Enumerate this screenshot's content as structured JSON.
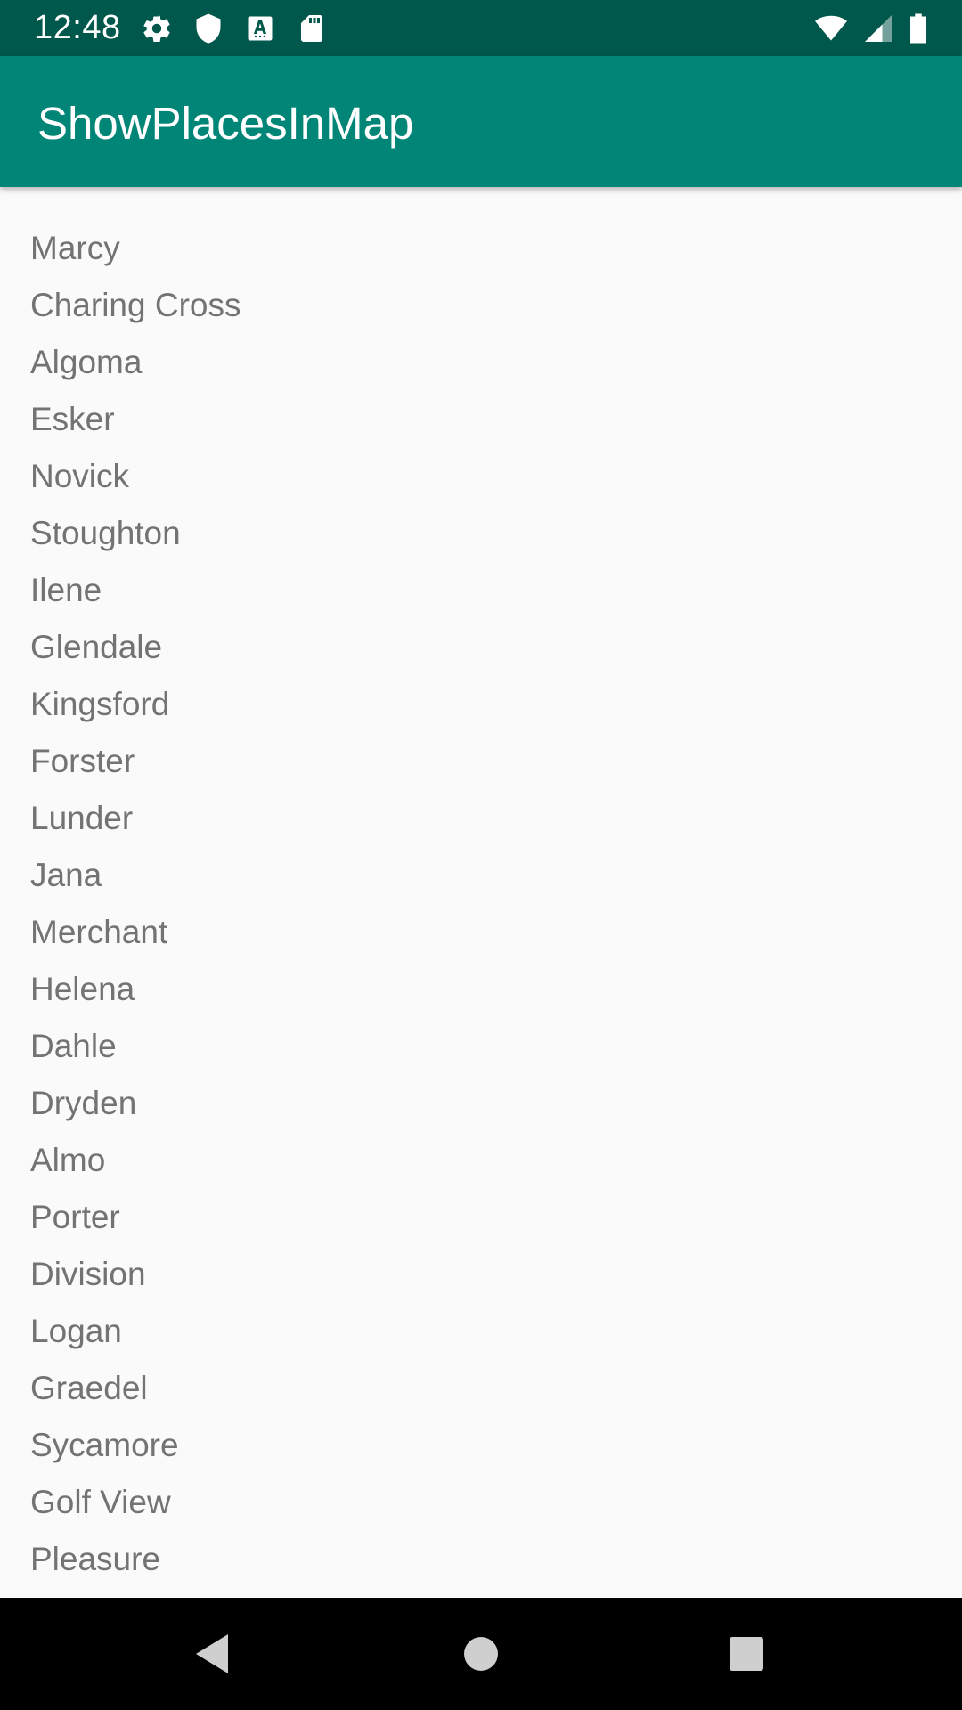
{
  "status_bar": {
    "time": "12:48",
    "left_icons": [
      "gear-icon",
      "shield-icon",
      "keyboard-a-icon",
      "sd-card-icon"
    ],
    "right_icons": [
      "wifi-icon",
      "cellular-signal-icon",
      "battery-icon"
    ]
  },
  "app_bar": {
    "title": "ShowPlacesInMap",
    "color": "#008577"
  },
  "places": [
    "Marcy",
    "Charing Cross",
    "Algoma",
    "Esker",
    "Novick",
    "Stoughton",
    "Ilene",
    "Glendale",
    "Kingsford",
    "Forster",
    "Lunder",
    "Jana",
    "Merchant",
    "Helena",
    "Dahle",
    "Dryden",
    "Almo",
    "Porter",
    "Division",
    "Logan",
    "Graedel",
    "Sycamore",
    "Golf View",
    "Pleasure"
  ],
  "nav_bar": {
    "buttons": [
      "back-icon",
      "home-icon",
      "recents-icon"
    ]
  }
}
